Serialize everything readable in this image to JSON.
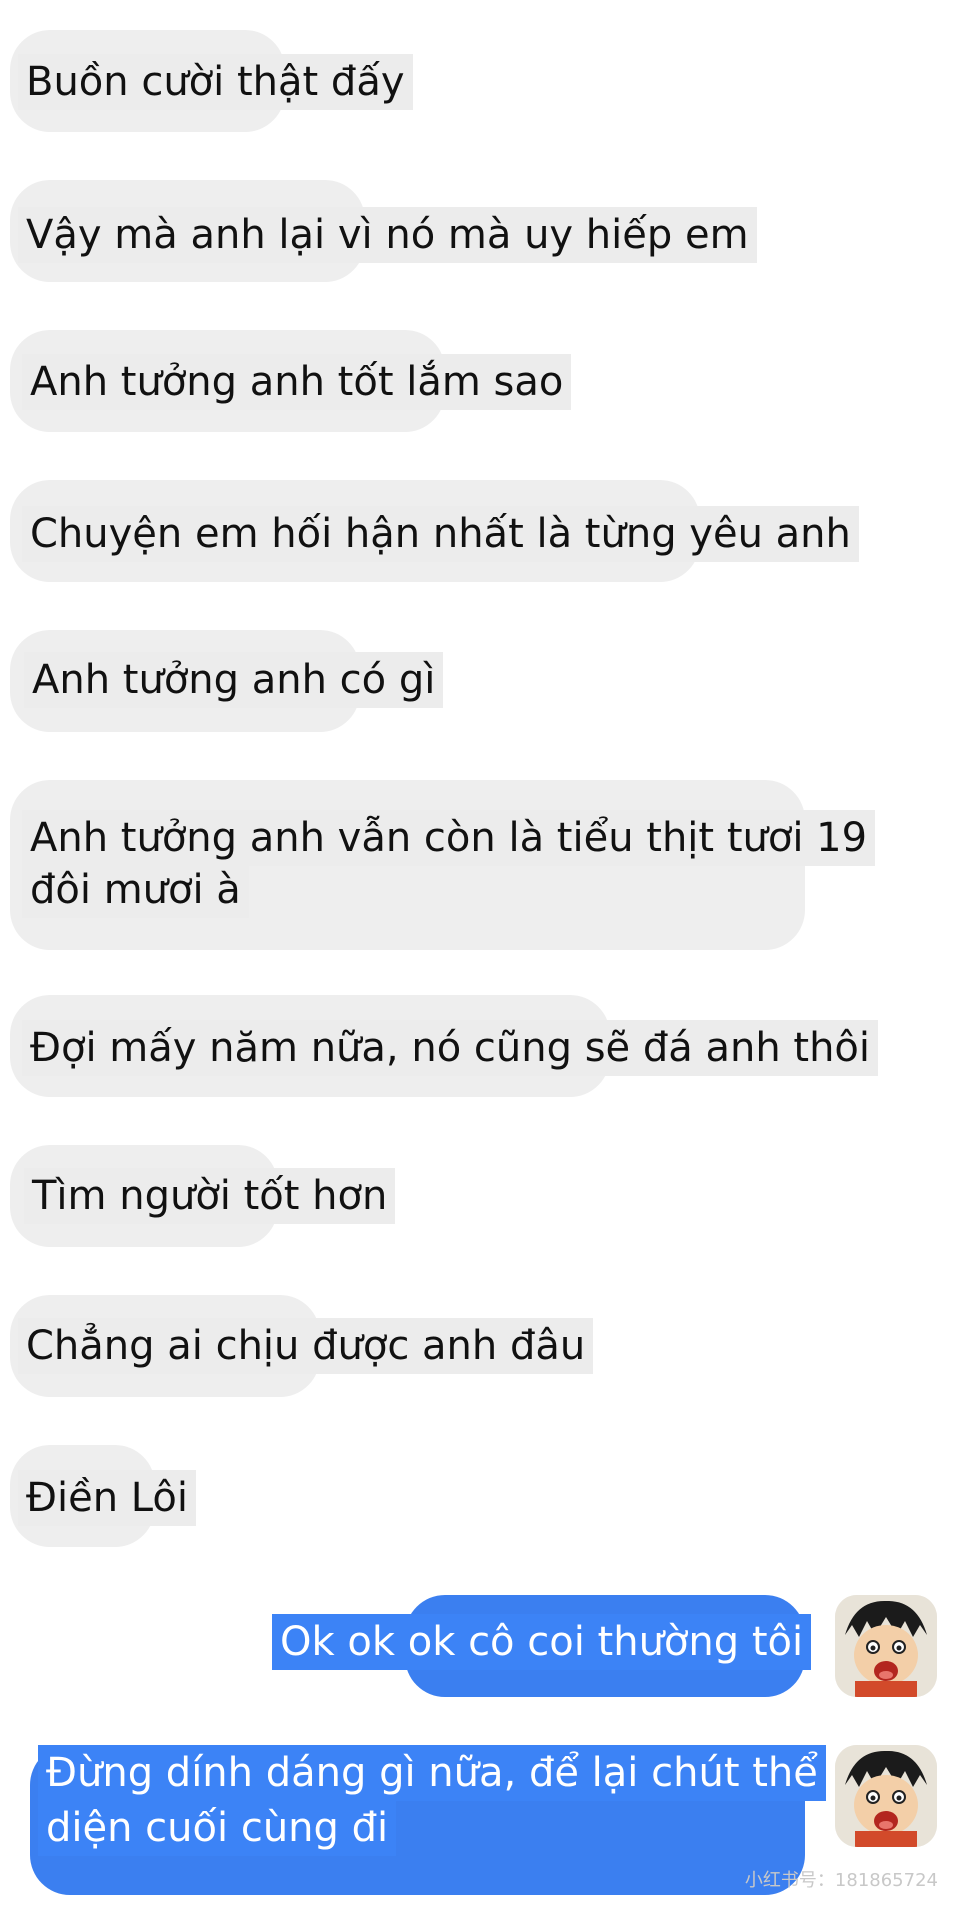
{
  "chat": {
    "received": [
      "Buồn cười thật đấy",
      "Vậy mà anh lại vì nó mà uy hiếp em",
      "Anh tưởng anh tốt lắm sao",
      "Chuyện em hối hận nhất là từng yêu anh",
      "Anh tưởng anh có gì",
      "Anh tưởng anh vẫn còn là tiểu thịt tươi 19",
      "đôi mươi à",
      "Đợi mấy năm nữa, nó cũng sẽ đá anh thôi",
      "Tìm người tốt hơn",
      "Chẳng ai chịu được anh đâu",
      "Điền Lôi"
    ],
    "sent": [
      "Ok ok ok cô coi thường tôi",
      "Đừng dính dáng gì nữa, để lại chút thể",
      "diện cuối cùng đi"
    ]
  },
  "watermark": "小红书号：181865724",
  "colors": {
    "received_bubble": "#eeeeee",
    "sent_bubble": "#3b7ff0",
    "sent_text": "#ffffff"
  }
}
